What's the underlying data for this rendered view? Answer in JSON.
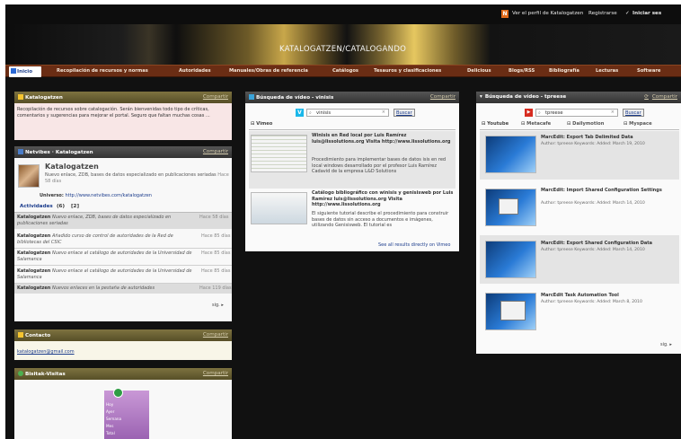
{
  "topbar": {
    "profile_link": "Ver el perfil de Katalogatzen",
    "register": "Registrarse",
    "login": "Iniciar ses"
  },
  "banner": {
    "title": "KATALOGATZEN/CATALOGANDO"
  },
  "tabs": [
    "Inicio",
    "Recopilación de recursos y normas",
    "Autoridades",
    "Manuales/Obras de referencia",
    "Catálogos",
    "Tesauros y clasificaciones",
    "Delicious",
    "Blogs/RSS",
    "Bibliografía",
    "Lecturas",
    "Software"
  ],
  "panel_katalogatzen": {
    "title": "Katalogatzen",
    "share": "Compartir",
    "text": "Recopilación de recursos sobre catalogación. Serán bienvenidas todo tipo de críticas, comentarios y sugerencias para mejorar el portal. Seguro que faltan muchas cosas ..."
  },
  "panel_netvibes": {
    "title": "Netvibes · Katalogatzen",
    "share": "Compartir",
    "name": "Katalogatzen",
    "desc": "Nuevo enlace, ZDB, bases de datos especializado en publicaciones seriadas",
    "desc_time": "Hace 58 días",
    "universe_label": "Universo:",
    "universe_url": "http://www.netvibes.com/katalogatzen",
    "tab_activities": "Actividades",
    "count_6": "(6)",
    "count_2": "[2]",
    "activities": [
      {
        "user": "Katalogatzen",
        "text": "Nuevo enlace, ZDB, bases de datos especializado en publicaciones seriadas",
        "time": "Hace 58 días"
      },
      {
        "user": "Katalogatzen",
        "text": "Añadido curso de control de autoridades de la Red de bibliotecas del CSIC",
        "time": "Hace 85 días"
      },
      {
        "user": "Katalogatzen",
        "text": "Nuevo enlace al catálogo de autoridades de la Universidad de Salamanca",
        "time": "Hace 85 días"
      },
      {
        "user": "Katalogatzen",
        "text": "Nuevo enlace al catálogo de autoridades de la Universidad de Salamanca",
        "time": "Hace 85 días"
      },
      {
        "user": "Katalogatzen",
        "text": "Nuevos enlaces en la pestaña de autoridades",
        "time": "Hace 119 días"
      }
    ],
    "next": "sig."
  },
  "panel_contacto": {
    "title": "Contacto",
    "share": "Compartir",
    "email": "katalogatzen@gmail.com"
  },
  "panel_bisitak": {
    "title": "Bisitak-Visitas",
    "share": "Compartir",
    "counter_rows": [
      "Hoy",
      "Ayer",
      "Semana",
      "Mes",
      "Total"
    ]
  },
  "panel_vinisis": {
    "title": "Búsqueda de vídeo - vinisis",
    "share": "Compartir",
    "query": "vinisis",
    "search_btn": "Buscar",
    "tab": "Vimeo",
    "results": [
      {
        "title": "Winisis en Red local por Luis Ramírez luis@lissolutions.org Visita http://www.lissolutions.org",
        "desc": "Procedimiento para implementar bases de datos isis en red local windows desarrollado por el profesor Luis Ramírez Cadavid de la empresa L&D Solutions"
      },
      {
        "title": "Catálogo bibliográfico con winisis y genisisweb por Luis Ramírez luis@lissolutions.org Visita http://www.lissolutions.org",
        "desc": "El siguiente tutorial describe el procedimiento para construir bases de datos sin acceso a documentos e imágenes, utilizando Genisisweb. El tutorial es"
      }
    ],
    "see_all": "See all results directly on Vimeo"
  },
  "panel_tpreese": {
    "title": "Búsqueda de vídeo - tpreese",
    "share": "Compartir",
    "query": "tpreese",
    "search_btn": "Buscar",
    "tabs": [
      "Youtube",
      "Metacafe",
      "Dailymotion",
      "Myspace"
    ],
    "results": [
      {
        "title": "MarcEdit: Export Tab Delimited Data",
        "meta": "Author: tpreese Keywords: Added: March 19, 2010"
      },
      {
        "title": "MarcEdit: Import Shared Configuration Settings",
        "meta": "Author: tpreese Keywords: Added: March 14, 2010"
      },
      {
        "title": "MarcEdit: Export Shared Configuration Data",
        "meta": "Author: tpreese Keywords: Added: March 14, 2010"
      },
      {
        "title": "MarcEdit Task Automation Tool",
        "meta": "Author: tpreese Keywords: Added: March 8, 2010"
      }
    ],
    "next": "sig."
  },
  "colors": {
    "tab_bar": "#6a2d14",
    "panel_header_olive": "#6b6233",
    "panel_header_dark": "#444444",
    "link": "#1b3c8c"
  }
}
